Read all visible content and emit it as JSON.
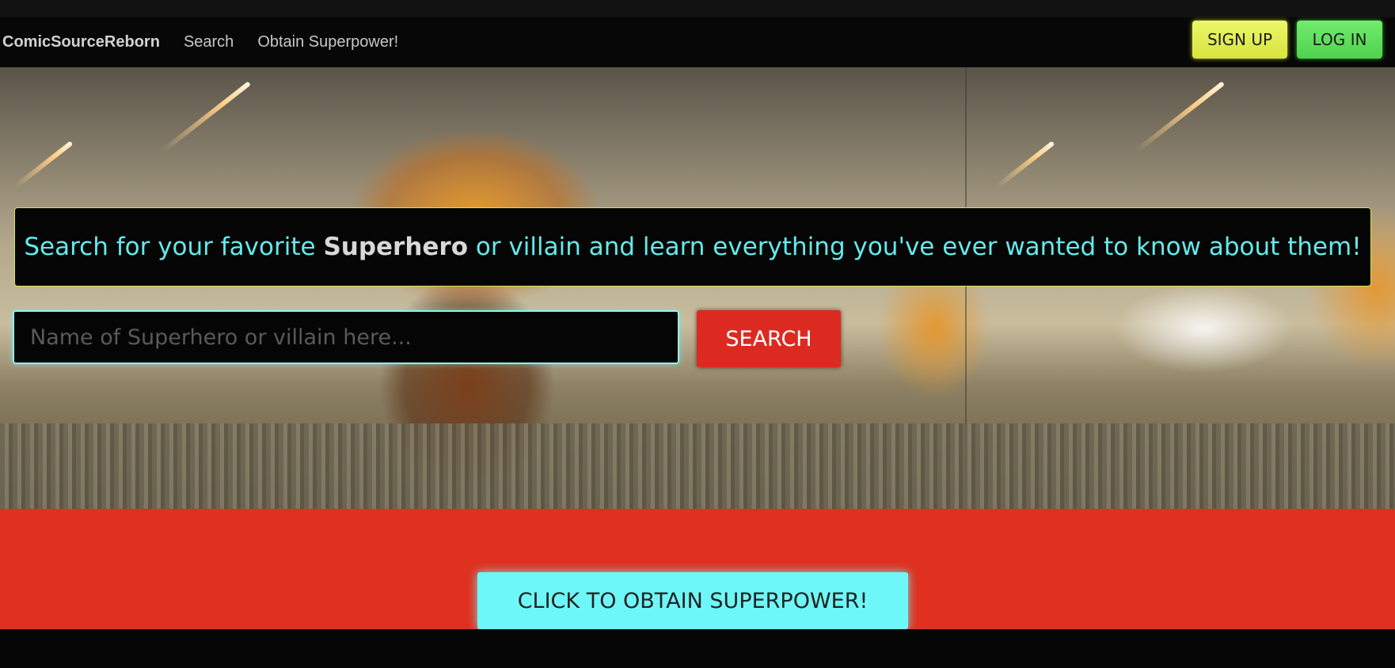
{
  "navbar": {
    "brand": "ComicSourceReborn",
    "links": [
      "Search",
      "Obtain Superpower!"
    ],
    "signup_label": "SIGN UP",
    "login_label": "LOG IN"
  },
  "hero": {
    "banner_prefix": "Search for your favorite ",
    "banner_emphasis": "Superhero",
    "banner_suffix": " or villain and learn everything you've ever wanted to know about them!",
    "search_placeholder": "Name of Superhero or villain here...",
    "search_button_label": "SEARCH"
  },
  "cta": {
    "button_label": "CLICK TO OBTAIN SUPERPOWER!"
  },
  "colors": {
    "banner_text": "#63e9ea",
    "search_button": "#dd2a20",
    "cta_band": "#e03020",
    "cta_button": "#6ef7f8",
    "signup_button": "#e3ef55",
    "login_button": "#5fdf5c"
  }
}
